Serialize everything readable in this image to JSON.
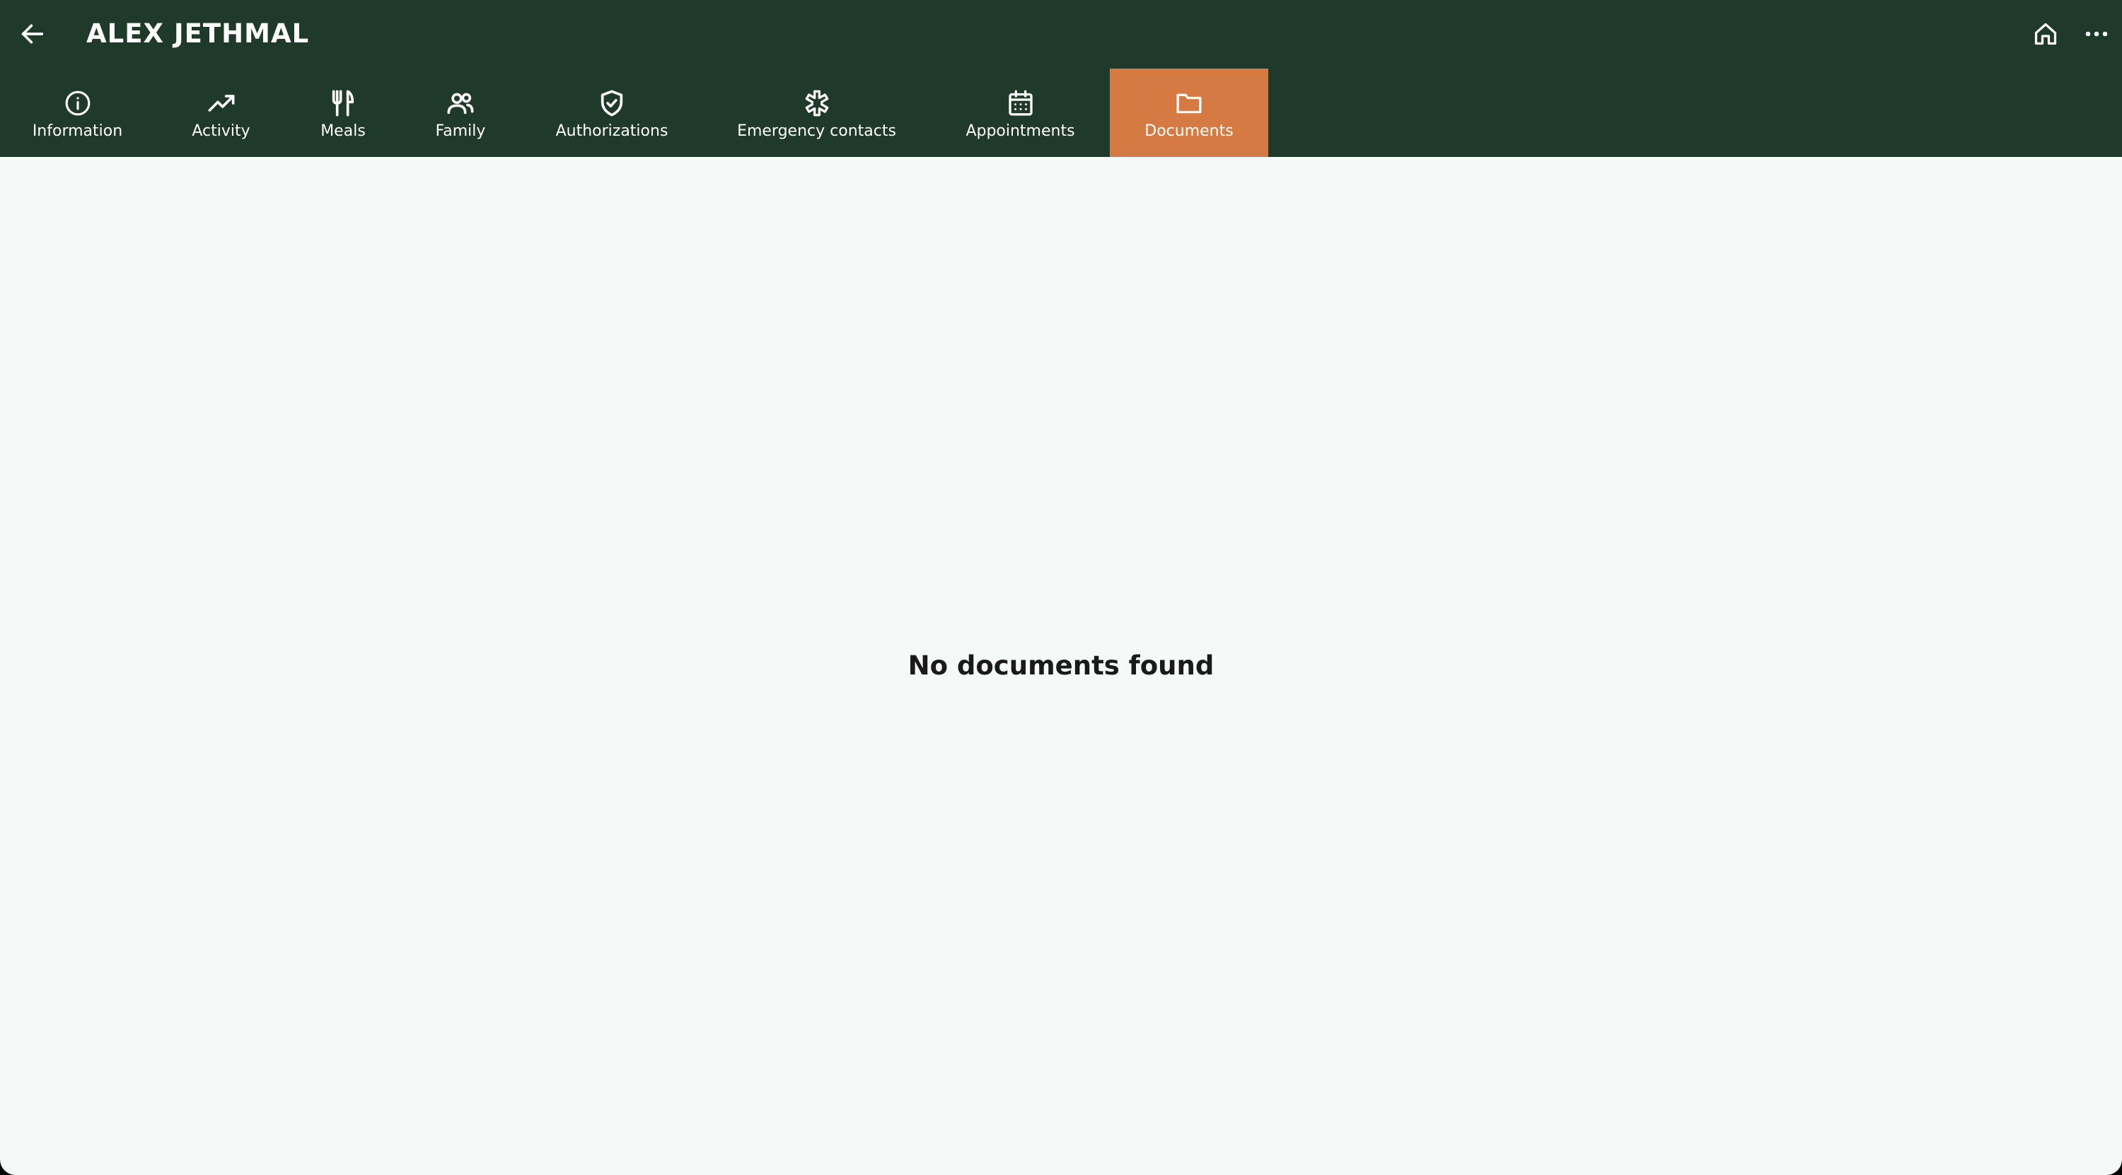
{
  "header": {
    "title": "ALEX JETHMAL",
    "back_icon": "arrow-left-icon",
    "home_icon": "home-icon",
    "more_icon": "more-horizontal-icon"
  },
  "tabs": [
    {
      "label": "Information",
      "icon": "info-icon",
      "active": false
    },
    {
      "label": "Activity",
      "icon": "trending-up-icon",
      "active": false
    },
    {
      "label": "Meals",
      "icon": "utensils-icon",
      "active": false
    },
    {
      "label": "Family",
      "icon": "users-icon",
      "active": false
    },
    {
      "label": "Authorizations",
      "icon": "shield-check-icon",
      "active": false
    },
    {
      "label": "Emergency contacts",
      "icon": "medical-cross-icon",
      "active": false
    },
    {
      "label": "Appointments",
      "icon": "calendar-icon",
      "active": false
    },
    {
      "label": "Documents",
      "icon": "folder-icon",
      "active": true
    }
  ],
  "main": {
    "empty_message": "No documents found"
  },
  "colors": {
    "header_bg": "#1f3a2a",
    "active_tab": "#d57a43",
    "content_bg": "#f5f9f8",
    "text_dark": "#1a1a1a",
    "text_light": "#ffffff"
  }
}
